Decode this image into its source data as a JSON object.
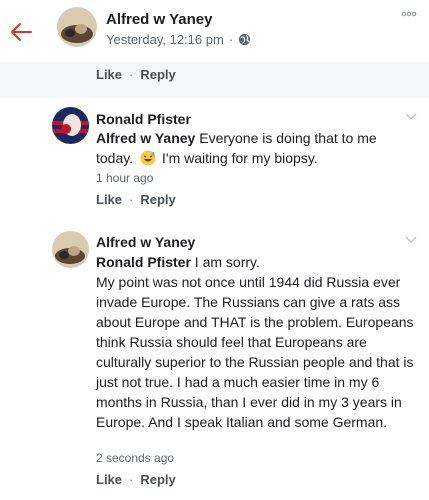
{
  "post": {
    "author": "Alfred w Yaney",
    "timestamp": "Yesterday, 12:16 pm",
    "separator": "·",
    "back_icon": "back-arrow-icon",
    "privacy_icon": "globe-icon",
    "more_icon": "more-options-icon"
  },
  "top_actions": {
    "like": "Like",
    "separator": "·",
    "reply": "Reply"
  },
  "comments": [
    {
      "author": "Ronald Pfister",
      "mention": "Alfred w Yaney",
      "text_before_emoji": " Everyone is doing that to me today.",
      "emoji": "grinning-sweat-emoji",
      "text_after_emoji": "I'm waiting for my biopsy.",
      "time": "1 hour ago",
      "like": "Like",
      "separator": "·",
      "reply": "Reply"
    },
    {
      "author": "Alfred w Yaney",
      "mention": "Ronald Pfister",
      "text": " I am sorry.\nMy point was not once until 1944 did Russia ever invade Europe. The Russians can give a rats ass about Europe and THAT is the problem. Europeans think Russia should feel that Europeans are culturally superior to the Russian people and that is just not true. I had a much easier time in my 6 months in Russia, than I ever did in my 3 years in Europe. And I speak Italian and some German.",
      "time": "2 seconds ago",
      "like": "Like",
      "separator": "·",
      "reply": "Reply"
    }
  ],
  "colors": {
    "accent_red": "#e4312b",
    "band_gray": "#f5f6f7"
  }
}
